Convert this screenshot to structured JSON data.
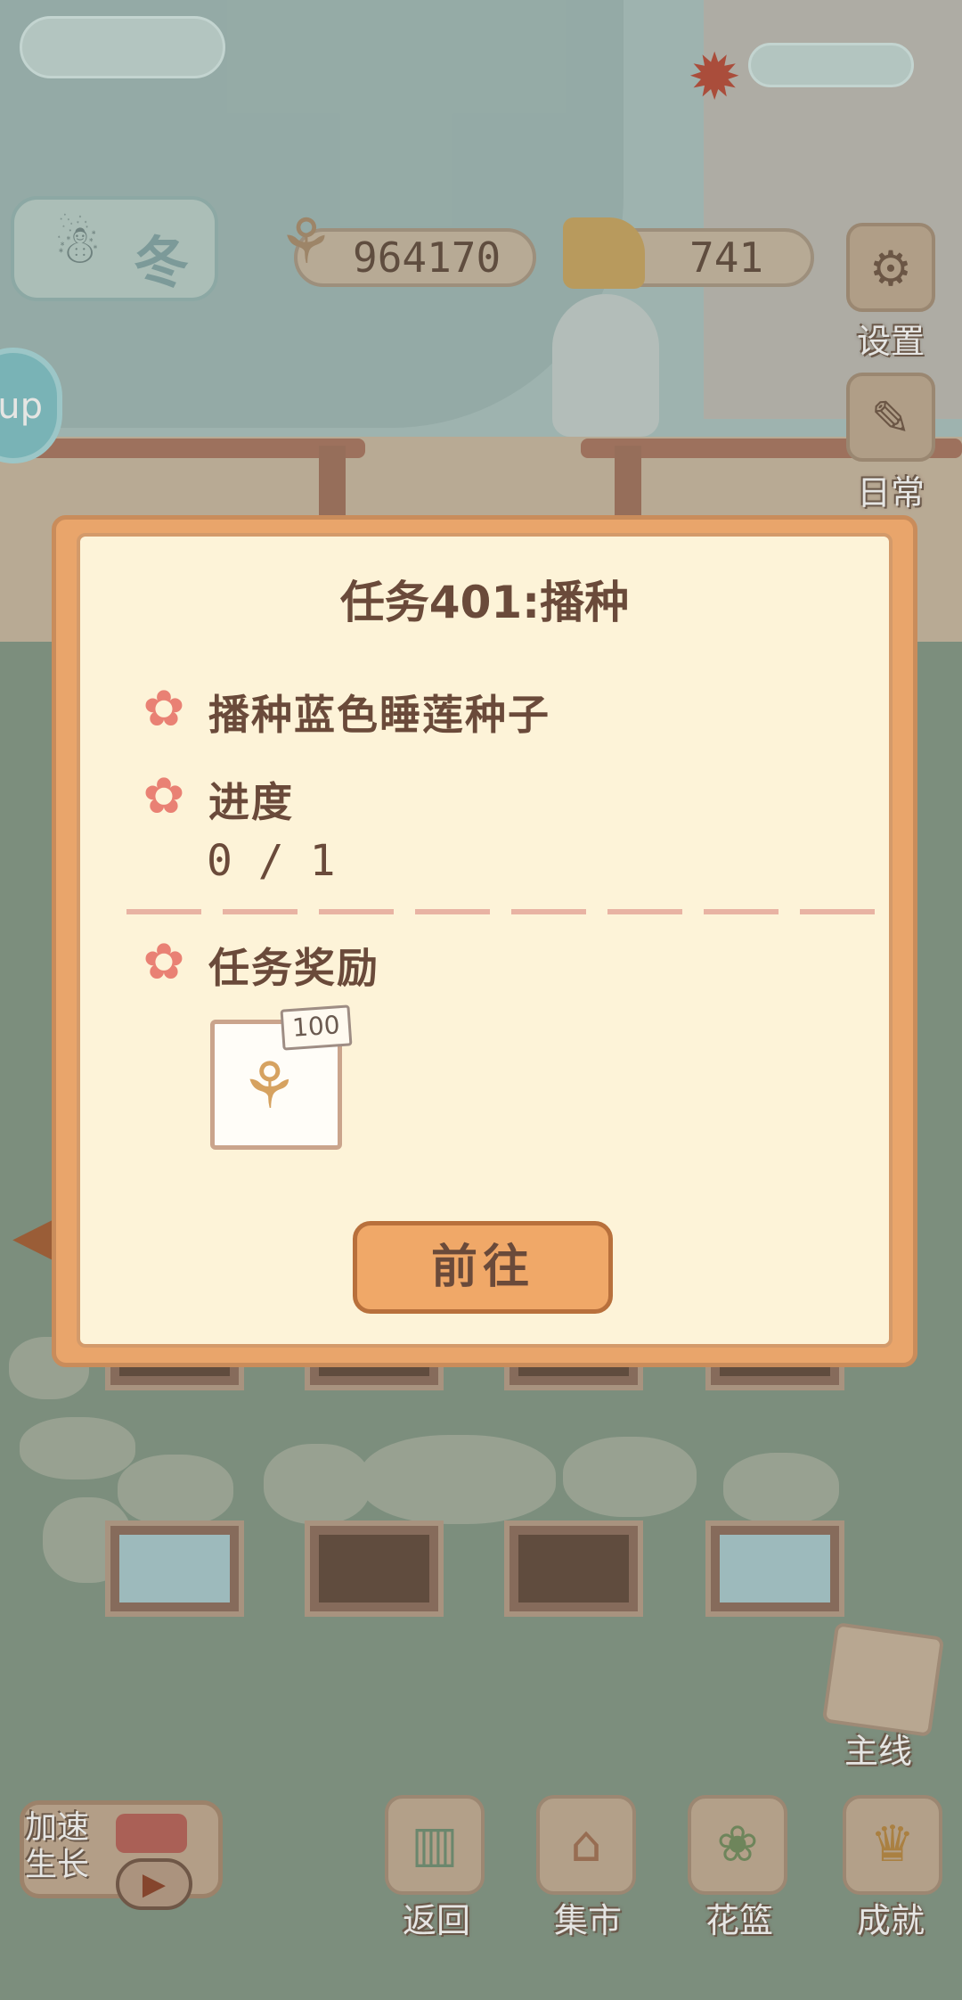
{
  "hud": {
    "season": "冬",
    "fish_currency": "964170",
    "cheese_currency": "741",
    "up_badge": "up"
  },
  "side_menu": {
    "settings_label": "设置",
    "daily_label": "日常",
    "mainline_label": "主线"
  },
  "speed": {
    "label": "加速生长"
  },
  "bottom_nav": {
    "back_label": "返回",
    "market_label": "集市",
    "basket_label": "花篮",
    "achievement_label": "成就"
  },
  "dialog": {
    "title": "任务401:播种",
    "task_desc": "播种蓝色睡莲种子",
    "progress_label": "进度",
    "progress_value": "0 / 1",
    "reward_label": "任务奖励",
    "reward_amount": "100",
    "go_button": "前往"
  },
  "colors": {
    "dialog_frame": "#e9a56b",
    "dialog_body": "#fdf3d8",
    "text_brown": "#6a4a3a",
    "flower_pink": "#e98174",
    "go_button": "#f0a868"
  },
  "icons": {
    "fish": "fish-bone-icon",
    "cheese": "cheese-icon",
    "settings": "gear-icon",
    "flower": "flower-icon"
  }
}
